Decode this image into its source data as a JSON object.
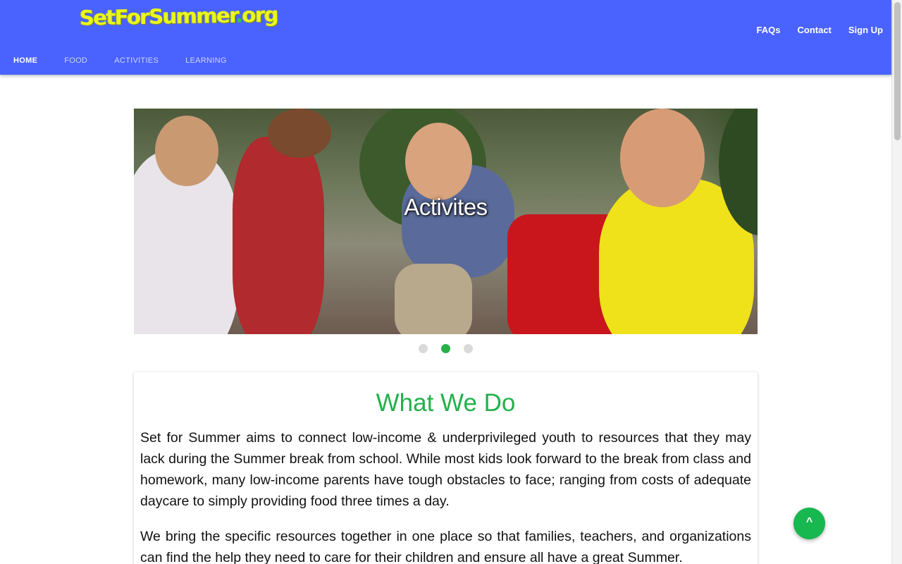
{
  "header": {
    "logo_text": "SetForSummer",
    "logo_dot": ".",
    "logo_tld": "org",
    "top_links": [
      "FAQs",
      "Contact",
      "Sign Up"
    ],
    "nav": [
      "HOME",
      "FOOD",
      "ACTIVITIES",
      "LEARNING"
    ],
    "active_nav": "HOME",
    "bar_color": "#4a63ff"
  },
  "carousel": {
    "caption": "Activites",
    "slide_count": 3,
    "active_slide": 2,
    "active_color": "#26b14a"
  },
  "section": {
    "title": "What We Do",
    "title_color": "#22b14a",
    "paragraphs": [
      "Set for Summer aims to connect low-income & underprivileged youth to resources that they may lack during the Summer break from school. While most kids look forward to the break from class and homework, many low-income parents have tough obstacles to face; ranging from costs of adequate daycare to simply providing food three times a day.",
      "We bring the specific resources together in one place so that families, teachers, and organizations can find the help they need to care for their children and ensure all have a great Summer."
    ]
  },
  "fab": {
    "icon": "chevron-up-icon",
    "glyph": "^"
  }
}
